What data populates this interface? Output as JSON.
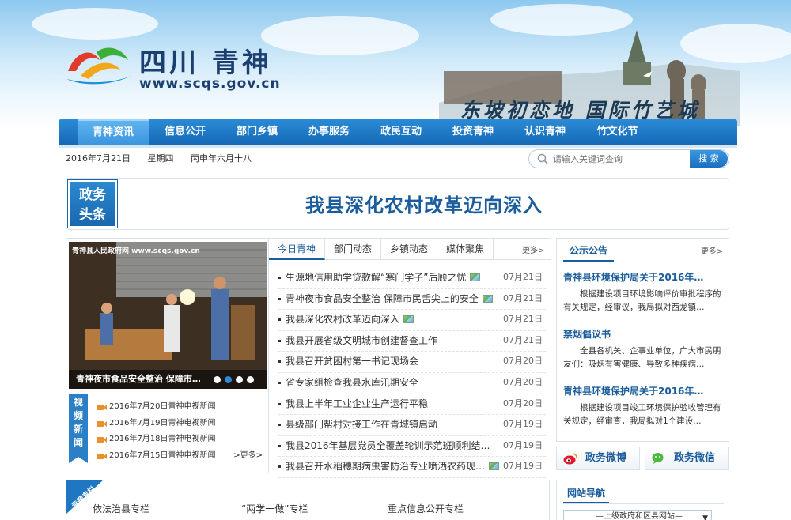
{
  "header": {
    "site_name": "四川  青神",
    "site_url": "www.scqs.gov.cn",
    "slogan": "东坡初恋地  国际竹艺城"
  },
  "nav": {
    "items": [
      "青神资讯",
      "信息公开",
      "部门乡镇",
      "办事服务",
      "政民互动",
      "投资青神",
      "认识青神",
      "竹文化节"
    ],
    "active": 0
  },
  "datebar": {
    "date": "2016年7月21日",
    "weekday": "星期四",
    "lunar": "丙申年六月十八"
  },
  "search": {
    "placeholder": "请输入关键词查询",
    "button": "搜 索"
  },
  "headline": {
    "badge_line1": "政务",
    "badge_line2": "头条",
    "title": "我县深化农村改革迈向深入"
  },
  "photo": {
    "caption": "青神夜市食品安全整治 保障市…",
    "watermark": "青神县人民政府网 www.scqs.gov.cn",
    "active_dot": 1
  },
  "video": {
    "tab_label": "视频新闻",
    "items": [
      "2016年7月20日青神电视新闻",
      "2016年7月19日青神电视新闻",
      "2016年7月18日青神电视新闻",
      "2016年7月15日青神电视新闻"
    ],
    "more": ">更多>"
  },
  "news_tabs": {
    "tabs": [
      "今日青神",
      "部门动态",
      "乡镇动态",
      "媒体聚焦"
    ],
    "active": 0,
    "more": "更多>"
  },
  "news": [
    {
      "title": "生源地信用助学贷款解“寒门学子”后顾之忧",
      "date": "07月21日",
      "pic": true
    },
    {
      "title": "青神夜市食品安全整治 保障市民舌尖上的安全",
      "date": "07月21日",
      "pic": true
    },
    {
      "title": "我县深化农村改革迈向深入",
      "date": "07月21日",
      "pic": true
    },
    {
      "title": "我县开展省级文明城市创建督查工作",
      "date": "07月21日",
      "pic": false
    },
    {
      "title": "我县召开贫困村第一书记现场会",
      "date": "07月20日",
      "pic": false
    },
    {
      "title": "省专家组检查我县水库汛期安全",
      "date": "07月20日",
      "pic": false
    },
    {
      "title": "我县上半年工业企业生产运行平稳",
      "date": "07月20日",
      "pic": false
    },
    {
      "title": "县级部门帮村对接工作在青城镇启动",
      "date": "07月19日",
      "pic": false
    },
    {
      "title": "我县2016年基层党员全覆盖轮训示范班顺利结…",
      "date": "07月19日",
      "pic": false
    },
    {
      "title": "我县召开水稻穗期病虫害防治专业喷洒农药现…",
      "date": "07月19日",
      "pic": true
    }
  ],
  "notices": {
    "title": "公示公告",
    "more": "更多>",
    "items": [
      {
        "title": "青神县环境保护局关于2016年…",
        "body": "根据建设项目环境影响评价审批程序的有关规定，经审议，我局拟对西龙镇…"
      },
      {
        "title": "禁烟倡议书",
        "body": "全县各机关、企事业单位，广大市民朋友们：吸烟有害健康、导致多种疾病…"
      },
      {
        "title": "青神县环境保护局关于2016年…",
        "body": "根据建设项目竣工环境保护验收管理有关规定，经审查，我局拟对1个建设…"
      }
    ]
  },
  "social": {
    "weibo": "政务微博",
    "weixin": "政务微信"
  },
  "special": {
    "tag": "专题专栏",
    "links": [
      "依法治县专栏",
      "“两学一做”专栏",
      "重点信息公开专栏"
    ]
  },
  "sitenav": {
    "title": "网站导航",
    "select": "—上级政府和区县网站—"
  },
  "colors": {
    "nav_blue": "#1568b6",
    "title_blue": "#1b5d9c",
    "panel_border": "#d7e2ec"
  }
}
